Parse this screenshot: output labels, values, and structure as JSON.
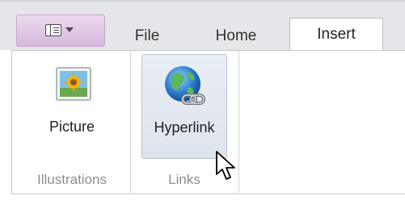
{
  "app_menu": {
    "icon": "panel-layout-icon",
    "arrow": "chevron-down-icon"
  },
  "tabs": [
    {
      "label": "File"
    },
    {
      "label": "Home"
    },
    {
      "label": "Insert",
      "selected": true
    }
  ],
  "ribbon": {
    "groups": [
      {
        "label": "Illustrations",
        "buttons": [
          {
            "label": "Picture",
            "icon": "picture-icon"
          }
        ]
      },
      {
        "label": "Links",
        "buttons": [
          {
            "label": "Hyperlink",
            "icon": "globe-link-icon",
            "hovered": true
          }
        ]
      }
    ]
  },
  "colors": {
    "app_menu": "#d6b8dc",
    "tabbar": "#e4e6e9",
    "hover": "#dde4ec"
  }
}
